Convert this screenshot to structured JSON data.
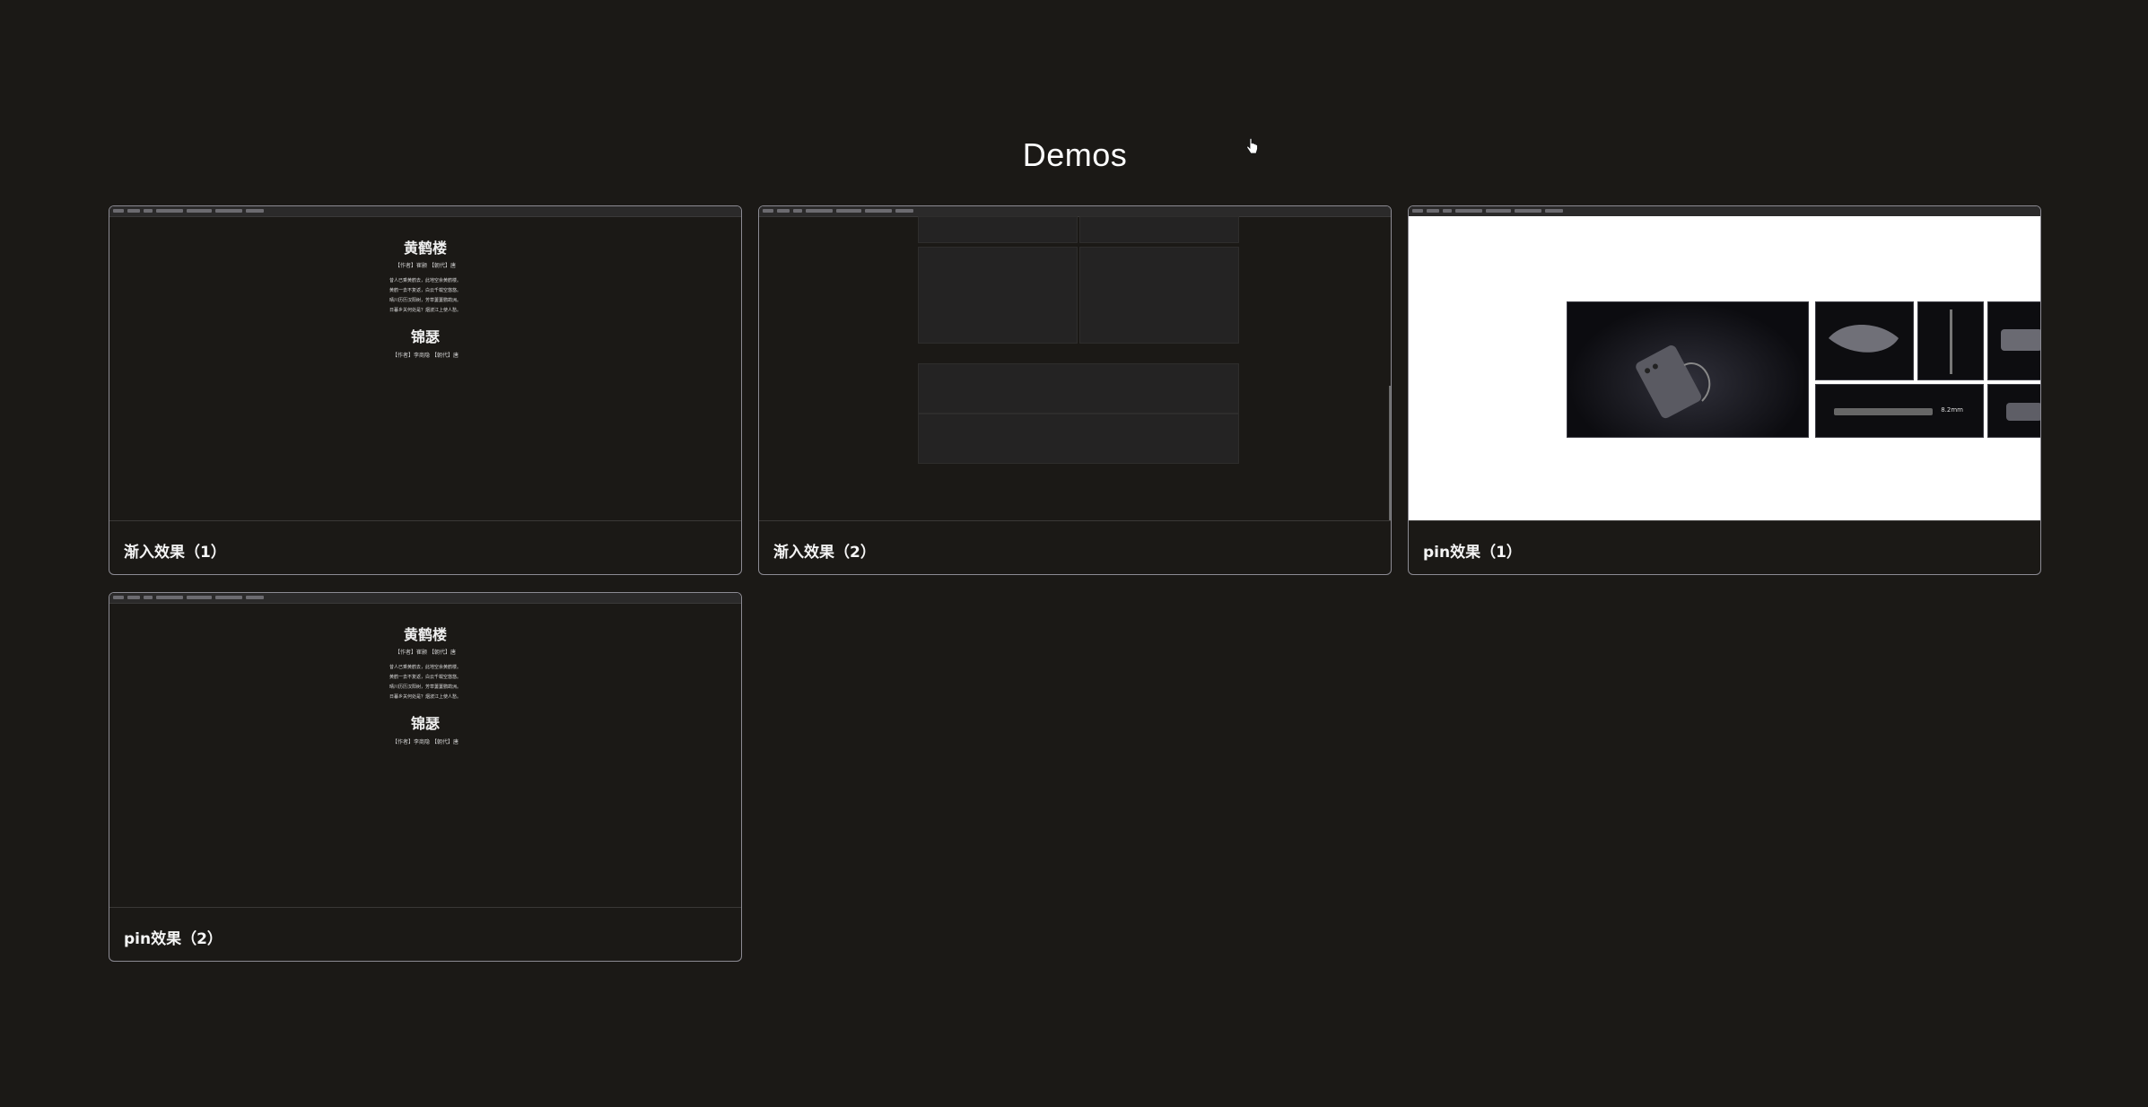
{
  "page": {
    "title": "Demos"
  },
  "poem": {
    "title1": "黄鹤楼",
    "meta1": "【作者】崔颢 【朝代】唐",
    "lines": [
      "昔人已乘黄鹤去，此地空余黄鹤楼。",
      "黄鹤一去不复返，白云千载空悠悠。",
      "晴川历历汉阳树，芳草萋萋鹦鹉洲。",
      "日暮乡关何处是？烟波江上使人愁。"
    ],
    "title2": "锦瑟",
    "meta2": "【作者】李商隐 【朝代】唐"
  },
  "cards": [
    {
      "label": "渐入效果（1）",
      "preview": "poem"
    },
    {
      "label": "渐入效果（2）",
      "preview": "grid"
    },
    {
      "label": "pin效果（1）",
      "preview": "product"
    },
    {
      "label": "pin效果（2）",
      "preview": "poem"
    }
  ],
  "product_preview": {
    "dimension_label": "8.2mm"
  },
  "colors": {
    "background": "#1b1916",
    "card_border": "#8c8b93",
    "text": "#f5f5f5"
  }
}
